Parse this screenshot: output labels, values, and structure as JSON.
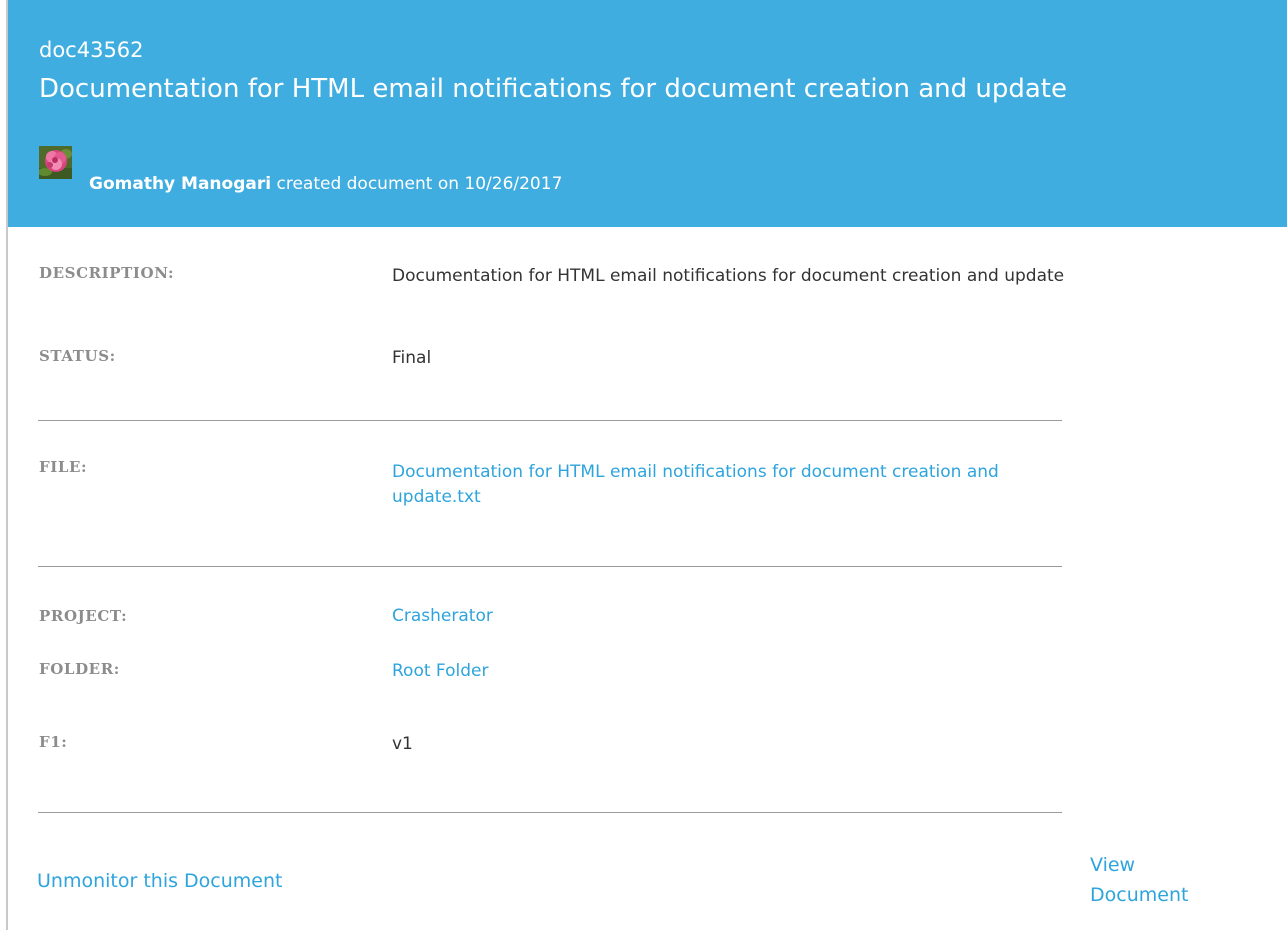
{
  "header": {
    "doc_id": "doc43562",
    "title": "Documentation for HTML email notifications for document creation and update",
    "author": "Gomathy Manogari",
    "action_text": "created document on 10/26/2017"
  },
  "fields": {
    "description": {
      "label": "DESCRIPTION:",
      "value": "Documentation for HTML email notifications for document creation and update"
    },
    "status": {
      "label": "STATUS:",
      "value": "Final"
    },
    "file": {
      "label": "FILE:",
      "value": "Documentation for HTML email notifications for document creation and update.txt"
    },
    "project": {
      "label": "PROJECT:",
      "value": "Crasherator"
    },
    "folder": {
      "label": "FOLDER:",
      "value": "Root Folder"
    },
    "f1": {
      "label": "F1:",
      "value": "v1"
    }
  },
  "actions": {
    "unmonitor": "Unmonitor this Document",
    "view_line1": "View",
    "view_line2": "Document"
  },
  "colors": {
    "header_bg": "#40ade0",
    "link": "#2ea4dd",
    "label": "#8c8c8c",
    "text": "#333333"
  },
  "icons": {
    "avatar": "rose-avatar-icon"
  }
}
